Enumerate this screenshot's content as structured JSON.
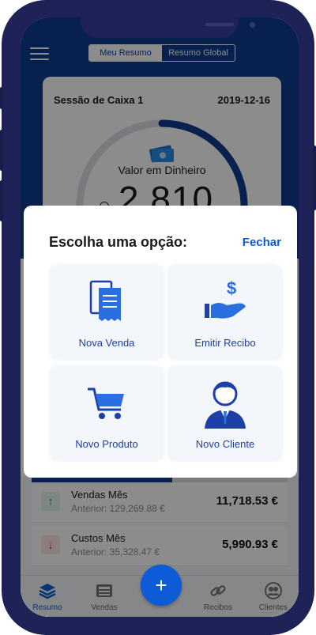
{
  "header": {
    "tabs": [
      {
        "label": "Meu Resumo",
        "active": true
      },
      {
        "label": "Resumo Global",
        "active": false
      }
    ]
  },
  "session_card": {
    "title": "Sessão de Caixa 1",
    "date": "2019-12-16",
    "gauge_label": "Valor em Dinheiro",
    "gauge_value": "2 810",
    "gauge_fraction": 0.55
  },
  "modal": {
    "title": "Escolha uma opção:",
    "close_label": "Fechar",
    "options": [
      {
        "label": "Nova Venda",
        "icon": "receipt-icon"
      },
      {
        "label": "Emitir Recibo",
        "icon": "hand-dollar-icon"
      },
      {
        "label": "Novo Produto",
        "icon": "cart-icon"
      },
      {
        "label": "Novo Cliente",
        "icon": "person-icon"
      }
    ]
  },
  "stats": {
    "progress_fraction": 0.55,
    "items": [
      {
        "name": "Vendas Mês",
        "previous": "Anterior: 129,269.88 €",
        "value": "11,718.53 €",
        "icon": "arrow-up-icon",
        "color": "#2e9e56"
      },
      {
        "name": "Custos Mês",
        "previous": "Anterior: 35,328.47 €",
        "value": "5,990.93 €",
        "icon": "arrow-down-icon",
        "color": "#d23c3c"
      }
    ]
  },
  "tabbar": {
    "items": [
      {
        "label": "Resumo",
        "icon": "layers-icon",
        "active": true
      },
      {
        "label": "Vendas",
        "icon": "register-icon",
        "active": false
      },
      {
        "label": "Recibos",
        "icon": "link-icon",
        "active": false
      },
      {
        "label": "Clientes",
        "icon": "users-icon",
        "active": false
      }
    ],
    "fab_symbol": "+"
  },
  "colors": {
    "primary": "#0d3b8e",
    "accent": "#0d5bd7",
    "frame": "#1e2257"
  }
}
